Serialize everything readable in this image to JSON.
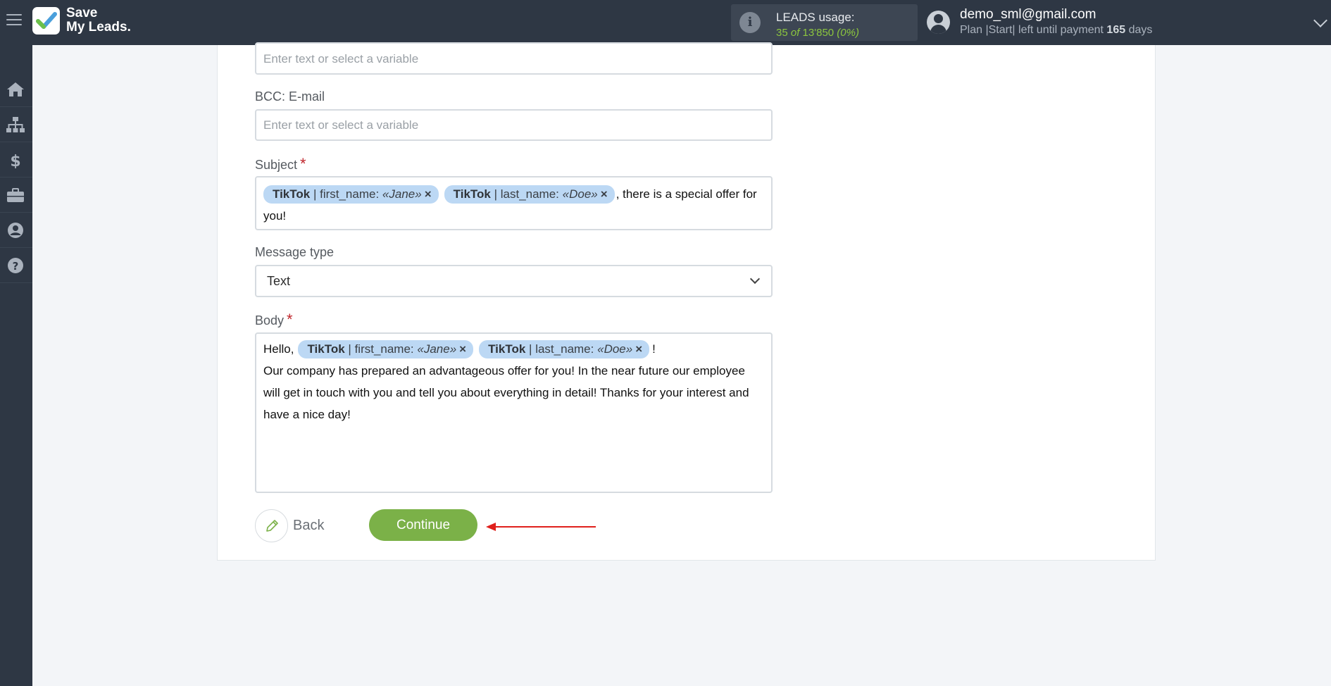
{
  "header": {
    "logo_line1": "Save",
    "logo_line2": "My Leads.",
    "usage_label": "LEADS usage:",
    "usage_used": "35",
    "usage_of": "of",
    "usage_total": "13'850",
    "usage_percent": "(0%)",
    "user_email": "demo_sml@gmail.com",
    "plan_text": "Plan |Start| left until payment",
    "plan_days": "165",
    "plan_days_unit": "days"
  },
  "sidebar": {
    "items": [
      "home-icon",
      "sitemap-icon",
      "dollar-icon",
      "briefcase-icon",
      "user-icon",
      "help-icon"
    ]
  },
  "form": {
    "cc_placeholder": "Enter text or select a variable",
    "bcc_label": "BCC: E-mail",
    "bcc_placeholder": "Enter text or select a variable",
    "subject_label": "Subject",
    "subject_required": "*",
    "subject_tags": [
      {
        "source": "TikTok",
        "field": "first_name:",
        "value": "«Jane»",
        "remove": "×"
      },
      {
        "source": "TikTok",
        "field": "last_name:",
        "value": "«Doe»",
        "remove": "×"
      }
    ],
    "subject_text1": ", there is a special offer for",
    "subject_text2": "you!",
    "message_type_label": "Message type",
    "message_type_value": "Text",
    "body_label": "Body",
    "body_required": "*",
    "body_prefix": "Hello,",
    "body_tags": [
      {
        "source": "TikTok",
        "field": "first_name:",
        "value": "«Jane»",
        "remove": "×"
      },
      {
        "source": "TikTok",
        "field": "last_name:",
        "value": "«Doe»",
        "remove": "×"
      }
    ],
    "body_suffix": "!",
    "body_line2": "Our company has prepared an advantageous offer for you! In the near future our employee",
    "body_line3": "will get in touch with you and tell you about everything in detail! Thanks for your interest and",
    "body_line4": "have a nice day!"
  },
  "actions": {
    "back_label": "Back",
    "continue_label": "Continue"
  },
  "colors": {
    "topbar": "#2e3744",
    "accent_green": "#7bb148",
    "tag_bg": "#bcd8f4",
    "arrow_red": "#e0201c"
  }
}
